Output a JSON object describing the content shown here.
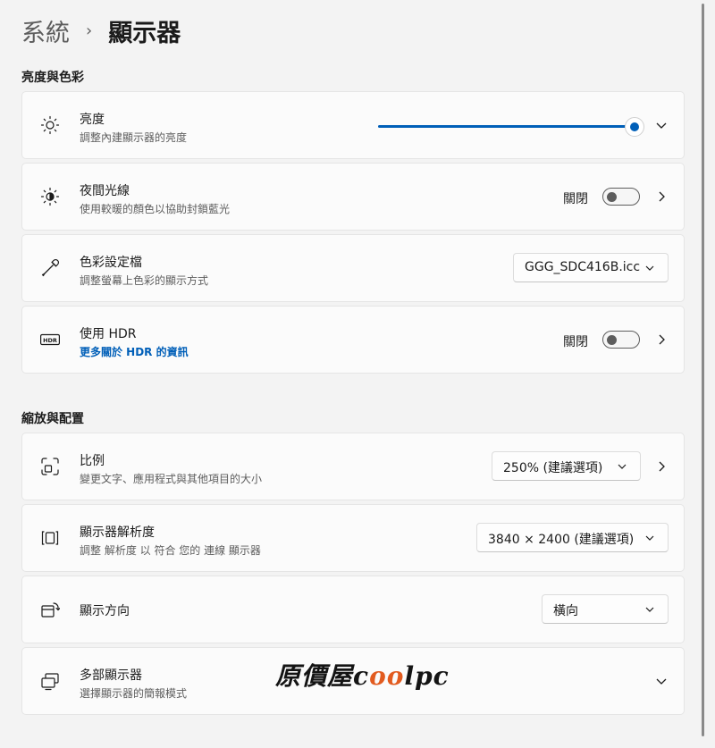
{
  "breadcrumb": {
    "parent": "系統",
    "separator": "›",
    "current": "顯示器"
  },
  "sections": {
    "brightness_color": "亮度與色彩",
    "scale_layout": "縮放與配置"
  },
  "brightness": {
    "title": "亮度",
    "subtitle": "調整內建顯示器的亮度",
    "level_percent": 100,
    "icon": "sun-icon"
  },
  "night_light": {
    "title": "夜間光線",
    "subtitle": "使用較暖的顏色以協助封鎖藍光",
    "state_label": "關閉",
    "toggle_on": false,
    "icon": "night-light-icon"
  },
  "color_profile": {
    "title": "色彩設定檔",
    "subtitle": "調整螢幕上色彩的顯示方式",
    "selected": "GGG_SDC416B.icc",
    "icon": "eyedropper-icon"
  },
  "hdr": {
    "title": "使用 HDR",
    "link": "更多關於 HDR 的資訊",
    "state_label": "關閉",
    "toggle_on": false,
    "icon": "hdr-icon",
    "icon_text": "HDR"
  },
  "scale": {
    "title": "比例",
    "subtitle": "變更文字、應用程式與其他項目的大小",
    "selected": "250% (建議選項)",
    "icon": "scale-icon"
  },
  "resolution": {
    "title": "顯示器解析度",
    "subtitle": "調整  解析度 以 符合 您的 連線 顯示器",
    "selected": "3840 × 2400 (建議選項)",
    "icon": "resolution-icon"
  },
  "orientation": {
    "title": "顯示方向",
    "selected": "橫向",
    "icon": "orientation-icon"
  },
  "multi_display": {
    "title": "多部顯示器",
    "subtitle": "選擇顯示器的簡報模式",
    "icon": "multi-display-icon"
  },
  "watermark": {
    "part1": "原價屋",
    "part2": "c",
    "part3": "oo",
    "part4": "lpc"
  },
  "colors": {
    "accent": "#005fb8",
    "background": "#f3f3f3",
    "card": "#fbfbfb"
  }
}
